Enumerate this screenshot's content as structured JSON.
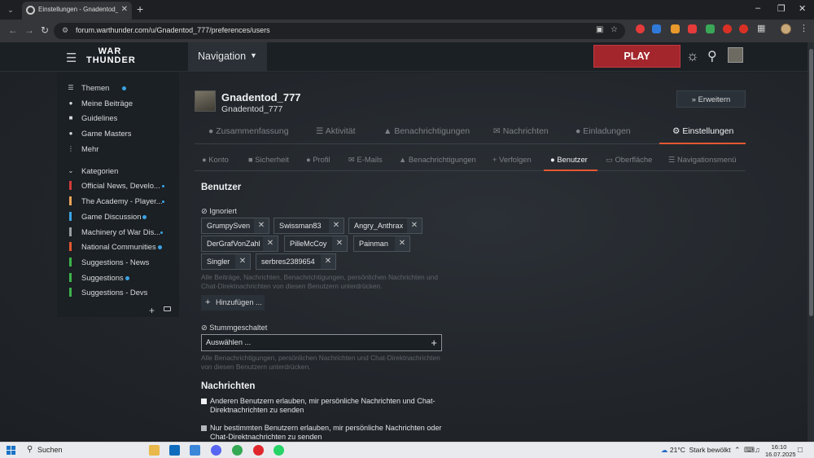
{
  "browser": {
    "tab_title": "Einstellungen - Gnadentod_777 - ...",
    "url": "forum.warthunder.com/u/Gnadentod_777/preferences/users"
  },
  "site": {
    "logo_top": "WAR",
    "logo_bottom": "THUNDER",
    "nav_label": "Navigation",
    "play_label": "PLAY"
  },
  "sidebar": {
    "items": [
      {
        "label": "Themen",
        "icon": "layers-icon"
      },
      {
        "label": "Meine Beiträge",
        "icon": "user-icon"
      },
      {
        "label": "Guidelines",
        "icon": "book-icon"
      },
      {
        "label": "Game Masters",
        "icon": "users-icon"
      },
      {
        "label": "Mehr",
        "icon": "vertical-dots-icon"
      }
    ],
    "categories_label": "Kategorien",
    "categories": [
      {
        "label": "Official News, Develo...",
        "color": "#d23a3a"
      },
      {
        "label": "The Academy - Player...",
        "color": "#e8a45a"
      },
      {
        "label": "Game Discussion",
        "color": "#3ba3e4"
      },
      {
        "label": "Machinery of War Dis...",
        "color": "#9a9ea3"
      },
      {
        "label": "National Communities",
        "color": "#e45731"
      },
      {
        "label": "Suggestions - News",
        "color": "#3db24b"
      },
      {
        "label": "Suggestions",
        "color": "#3db24b"
      },
      {
        "label": "Suggestions - Devs",
        "color": "#3db24b"
      }
    ]
  },
  "profile": {
    "name": "Gnadentod_777",
    "username": "Gnadentod_777",
    "expand_label": "Erweitern"
  },
  "tabs": [
    {
      "label": "Zusammenfassung",
      "icon": "user-icon"
    },
    {
      "label": "Aktivität",
      "icon": "activity-icon"
    },
    {
      "label": "Benachrichtigungen",
      "icon": "bell-icon"
    },
    {
      "label": "Nachrichten",
      "icon": "envelope-icon"
    },
    {
      "label": "Einladungen",
      "icon": "user-plus-icon"
    },
    {
      "label": "Einstellungen",
      "icon": "gear-icon"
    }
  ],
  "subtabs": [
    {
      "label": "Konto",
      "icon": "user-icon"
    },
    {
      "label": "Sicherheit",
      "icon": "lock-icon"
    },
    {
      "label": "Profil",
      "icon": "user-icon"
    },
    {
      "label": "E-Mails",
      "icon": "envelope-icon"
    },
    {
      "label": "Benachrichtigungen",
      "icon": "bell-icon"
    },
    {
      "label": "Verfolgen",
      "icon": "plus-icon"
    },
    {
      "label": "Benutzer",
      "icon": "users-icon"
    },
    {
      "label": "Oberfläche",
      "icon": "monitor-icon"
    },
    {
      "label": "Navigationsmenü",
      "icon": "bars-icon"
    }
  ],
  "users_section": {
    "title": "Benutzer",
    "ignored_label": "Ignoriert",
    "ignored_users": [
      "GrumpySven",
      "Swissman83",
      "Angry_Anthrax",
      "DerGrafVonZahl",
      "PilleMcCoy",
      "Painman",
      "Singler",
      "serbres2389654"
    ],
    "ignored_hint": "Alle Beiträge, Nachrichten, Benachrichtigungen, persönlichen Nachrichten und Chat-Direktnachrichten von diesen Benutzern unterdrücken.",
    "add_label": "Hinzufügen ...",
    "muted_label": "Stummgeschaltet",
    "muted_placeholder": "Auswählen ...",
    "muted_hint": "Alle Benachrichtigungen, persönlichen Nachrichten und Chat-Direktnachrichten von diesen Benutzern unterdrücken."
  },
  "messages_section": {
    "title": "Nachrichten",
    "options": [
      {
        "label": "Anderen Benutzern erlauben, mir persönliche Nachrichten und Chat-Direktnachrichten zu senden",
        "checked": false
      },
      {
        "label": "Nur bestimmten Benutzern erlauben, mir persönliche Nachrichten oder Chat-Direktnachrichten zu senden",
        "checked": false
      }
    ]
  },
  "taskbar": {
    "search_label": "Suchen",
    "temperature": "21°C",
    "weather": "Stark bewölkt",
    "time": "16:10",
    "date": "16.07.2025"
  },
  "colors": {
    "accent": "#e45731",
    "play": "#a3262d",
    "new_dot": "#3ba3e4"
  }
}
